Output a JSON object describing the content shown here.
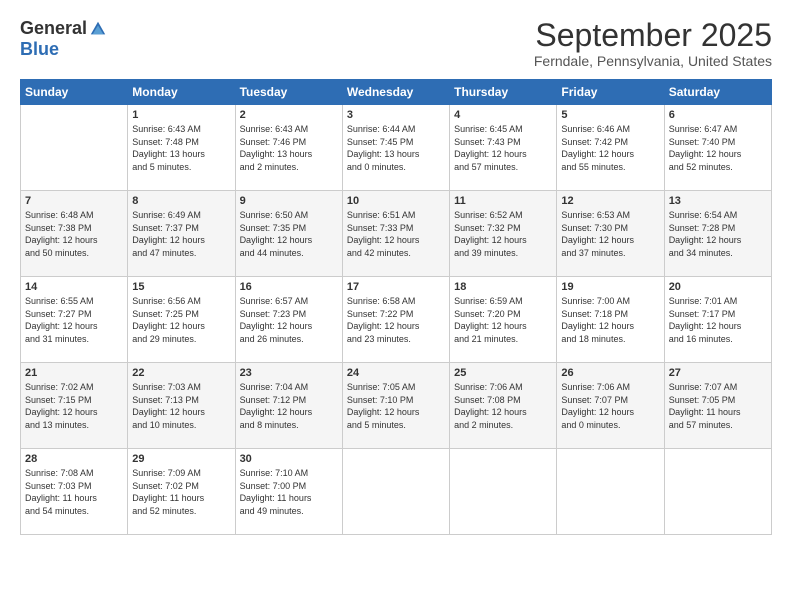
{
  "logo": {
    "general": "General",
    "blue": "Blue"
  },
  "title": "September 2025",
  "location": "Ferndale, Pennsylvania, United States",
  "headers": [
    "Sunday",
    "Monday",
    "Tuesday",
    "Wednesday",
    "Thursday",
    "Friday",
    "Saturday"
  ],
  "weeks": [
    [
      {
        "day": "",
        "info": ""
      },
      {
        "day": "1",
        "info": "Sunrise: 6:43 AM\nSunset: 7:48 PM\nDaylight: 13 hours\nand 5 minutes."
      },
      {
        "day": "2",
        "info": "Sunrise: 6:43 AM\nSunset: 7:46 PM\nDaylight: 13 hours\nand 2 minutes."
      },
      {
        "day": "3",
        "info": "Sunrise: 6:44 AM\nSunset: 7:45 PM\nDaylight: 13 hours\nand 0 minutes."
      },
      {
        "day": "4",
        "info": "Sunrise: 6:45 AM\nSunset: 7:43 PM\nDaylight: 12 hours\nand 57 minutes."
      },
      {
        "day": "5",
        "info": "Sunrise: 6:46 AM\nSunset: 7:42 PM\nDaylight: 12 hours\nand 55 minutes."
      },
      {
        "day": "6",
        "info": "Sunrise: 6:47 AM\nSunset: 7:40 PM\nDaylight: 12 hours\nand 52 minutes."
      }
    ],
    [
      {
        "day": "7",
        "info": "Sunrise: 6:48 AM\nSunset: 7:38 PM\nDaylight: 12 hours\nand 50 minutes."
      },
      {
        "day": "8",
        "info": "Sunrise: 6:49 AM\nSunset: 7:37 PM\nDaylight: 12 hours\nand 47 minutes."
      },
      {
        "day": "9",
        "info": "Sunrise: 6:50 AM\nSunset: 7:35 PM\nDaylight: 12 hours\nand 44 minutes."
      },
      {
        "day": "10",
        "info": "Sunrise: 6:51 AM\nSunset: 7:33 PM\nDaylight: 12 hours\nand 42 minutes."
      },
      {
        "day": "11",
        "info": "Sunrise: 6:52 AM\nSunset: 7:32 PM\nDaylight: 12 hours\nand 39 minutes."
      },
      {
        "day": "12",
        "info": "Sunrise: 6:53 AM\nSunset: 7:30 PM\nDaylight: 12 hours\nand 37 minutes."
      },
      {
        "day": "13",
        "info": "Sunrise: 6:54 AM\nSunset: 7:28 PM\nDaylight: 12 hours\nand 34 minutes."
      }
    ],
    [
      {
        "day": "14",
        "info": "Sunrise: 6:55 AM\nSunset: 7:27 PM\nDaylight: 12 hours\nand 31 minutes."
      },
      {
        "day": "15",
        "info": "Sunrise: 6:56 AM\nSunset: 7:25 PM\nDaylight: 12 hours\nand 29 minutes."
      },
      {
        "day": "16",
        "info": "Sunrise: 6:57 AM\nSunset: 7:23 PM\nDaylight: 12 hours\nand 26 minutes."
      },
      {
        "day": "17",
        "info": "Sunrise: 6:58 AM\nSunset: 7:22 PM\nDaylight: 12 hours\nand 23 minutes."
      },
      {
        "day": "18",
        "info": "Sunrise: 6:59 AM\nSunset: 7:20 PM\nDaylight: 12 hours\nand 21 minutes."
      },
      {
        "day": "19",
        "info": "Sunrise: 7:00 AM\nSunset: 7:18 PM\nDaylight: 12 hours\nand 18 minutes."
      },
      {
        "day": "20",
        "info": "Sunrise: 7:01 AM\nSunset: 7:17 PM\nDaylight: 12 hours\nand 16 minutes."
      }
    ],
    [
      {
        "day": "21",
        "info": "Sunrise: 7:02 AM\nSunset: 7:15 PM\nDaylight: 12 hours\nand 13 minutes."
      },
      {
        "day": "22",
        "info": "Sunrise: 7:03 AM\nSunset: 7:13 PM\nDaylight: 12 hours\nand 10 minutes."
      },
      {
        "day": "23",
        "info": "Sunrise: 7:04 AM\nSunset: 7:12 PM\nDaylight: 12 hours\nand 8 minutes."
      },
      {
        "day": "24",
        "info": "Sunrise: 7:05 AM\nSunset: 7:10 PM\nDaylight: 12 hours\nand 5 minutes."
      },
      {
        "day": "25",
        "info": "Sunrise: 7:06 AM\nSunset: 7:08 PM\nDaylight: 12 hours\nand 2 minutes."
      },
      {
        "day": "26",
        "info": "Sunrise: 7:06 AM\nSunset: 7:07 PM\nDaylight: 12 hours\nand 0 minutes."
      },
      {
        "day": "27",
        "info": "Sunrise: 7:07 AM\nSunset: 7:05 PM\nDaylight: 11 hours\nand 57 minutes."
      }
    ],
    [
      {
        "day": "28",
        "info": "Sunrise: 7:08 AM\nSunset: 7:03 PM\nDaylight: 11 hours\nand 54 minutes."
      },
      {
        "day": "29",
        "info": "Sunrise: 7:09 AM\nSunset: 7:02 PM\nDaylight: 11 hours\nand 52 minutes."
      },
      {
        "day": "30",
        "info": "Sunrise: 7:10 AM\nSunset: 7:00 PM\nDaylight: 11 hours\nand 49 minutes."
      },
      {
        "day": "",
        "info": ""
      },
      {
        "day": "",
        "info": ""
      },
      {
        "day": "",
        "info": ""
      },
      {
        "day": "",
        "info": ""
      }
    ]
  ]
}
